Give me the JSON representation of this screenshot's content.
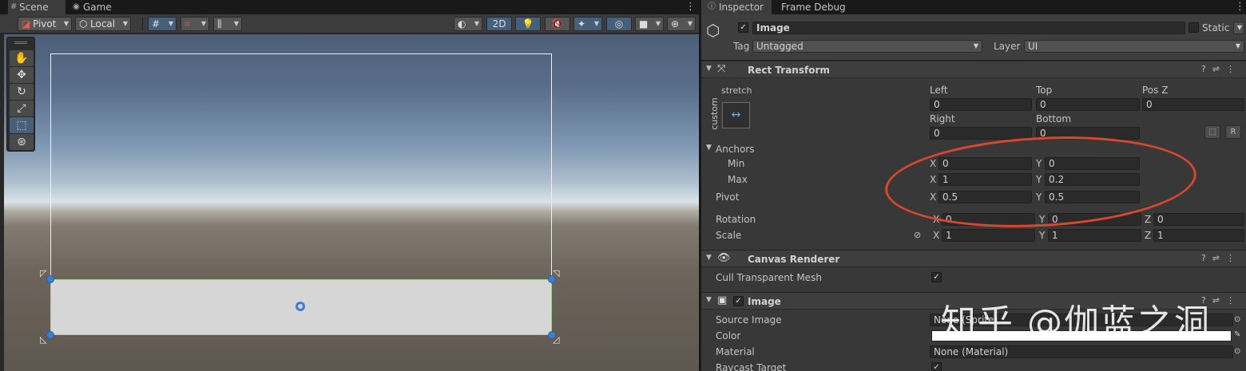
{
  "scene_window": {
    "tabs": [
      {
        "label": "Scene",
        "icon": "grid-icon"
      },
      {
        "label": "Game",
        "icon": "gamepad-icon"
      }
    ],
    "toolbar": {
      "pivot": "Pivot",
      "local": "Local",
      "mode_2d": "2D"
    },
    "tools": [
      "hand",
      "move",
      "rotate",
      "scale",
      "rect",
      "transform"
    ],
    "active_tool": "rect"
  },
  "inspector": {
    "tabs": [
      {
        "label": "Inspector",
        "icon": "info-icon"
      },
      {
        "label": "Frame Debug"
      }
    ],
    "object": {
      "enabled": "✓",
      "name": "Image",
      "static_label": "Static",
      "tag_label": "Tag",
      "tag_value": "Untagged",
      "layer_label": "Layer",
      "layer_value": "UI"
    },
    "rect_transform": {
      "title": "Rect Transform",
      "anchor_preset_top": "stretch",
      "anchor_preset_side": "custom",
      "left_label": "Left",
      "left": "0",
      "top_label": "Top",
      "top": "0",
      "posz_label": "Pos Z",
      "posz": "0",
      "right_label": "Right",
      "right": "0",
      "bottom_label": "Bottom",
      "bottom": "0",
      "r_button": "R",
      "anchors_label": "Anchors",
      "min_label": "Min",
      "min_x": "0",
      "min_y": "0",
      "max_label": "Max",
      "max_x": "1",
      "max_y": "0.2",
      "pivot_label": "Pivot",
      "pivot_x": "0.5",
      "pivot_y": "0.5",
      "rotation_label": "Rotation",
      "rot_x": "0",
      "rot_y": "0",
      "rot_z": "0",
      "scale_label": "Scale",
      "scale_x": "1",
      "scale_y": "1",
      "scale_z": "1",
      "axis_x": "X",
      "axis_y": "Y",
      "axis_z": "Z"
    },
    "canvas_renderer": {
      "title": "Canvas Renderer",
      "cull_label": "Cull Transparent Mesh",
      "cull_value": "✓"
    },
    "image_component": {
      "title": "Image",
      "enabled": "✓",
      "source_image_label": "Source Image",
      "source_image_value": "None (Sprite)",
      "color_label": "Color",
      "color_value": "#ffffff",
      "material_label": "Material",
      "material_value": "None (Material)",
      "raycast_label": "Raycast Target",
      "raycast_value": "✓"
    }
  },
  "watermark": "知乎 @伽蓝之洞",
  "colors": {
    "accent_blue": "#46607c",
    "annotation_red": "#d9472e",
    "handle_blue": "#3a7fd0"
  }
}
